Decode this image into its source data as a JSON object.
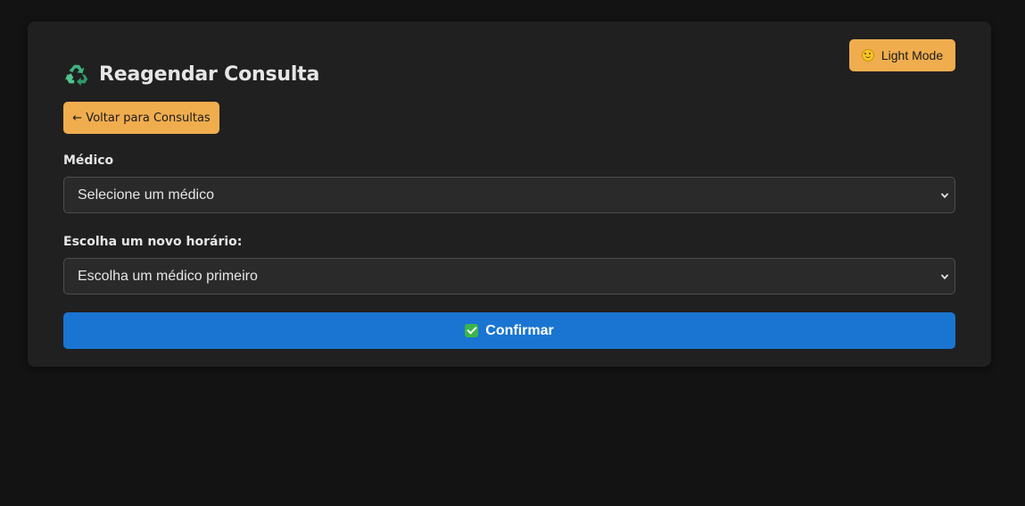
{
  "theme_toggle": {
    "label": "Light Mode",
    "icon": "smiley-icon"
  },
  "header": {
    "title": "Reagendar Consulta",
    "icon": "recycle-icon"
  },
  "back_button": {
    "label": "← Voltar para Consultas"
  },
  "form": {
    "doctor": {
      "label": "Médico",
      "selected_value": "Selecione um médico"
    },
    "time_slot": {
      "label": "Escolha um novo horário:",
      "selected_value": "Escolha um médico primeiro"
    },
    "confirm_button": {
      "label": "Confirmar",
      "icon": "check-icon"
    }
  },
  "colors": {
    "page_background": "#131313",
    "card_background": "#202020",
    "accent_orange": "#f0ad4e",
    "primary_blue": "#1a75d2",
    "text": "#e6e6e6"
  }
}
